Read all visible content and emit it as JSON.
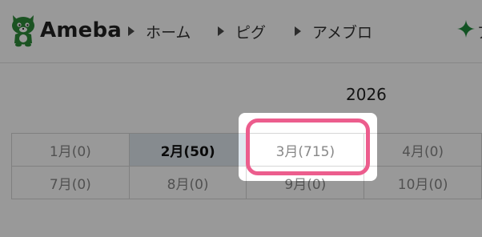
{
  "header": {
    "logo_text": "Ameba",
    "logo_icon": "ameba-mascot-icon",
    "breadcrumbs": [
      {
        "label": "ホーム"
      },
      {
        "label": "ピグ"
      },
      {
        "label": "アメブロ"
      }
    ],
    "sparkle_icon": "sparkle-icon",
    "sparkle_color": "#1f8a3b",
    "truncated_label": "ア"
  },
  "archive": {
    "year": "2026",
    "months": [
      {
        "label": "1月(0)"
      },
      {
        "label": "2月(50)",
        "current": true
      },
      {
        "label": "3月(715)",
        "highlighted": true
      },
      {
        "label": "4月(0)"
      },
      {
        "label": "7月(0)"
      },
      {
        "label": "8月(0)"
      },
      {
        "label": "9月(0)"
      },
      {
        "label": "10月(0)"
      }
    ]
  },
  "colors": {
    "brand_green": "#2e8b3a",
    "highlight_pink": "#ec5d8d",
    "current_month_bg": "#dfe8ef"
  }
}
